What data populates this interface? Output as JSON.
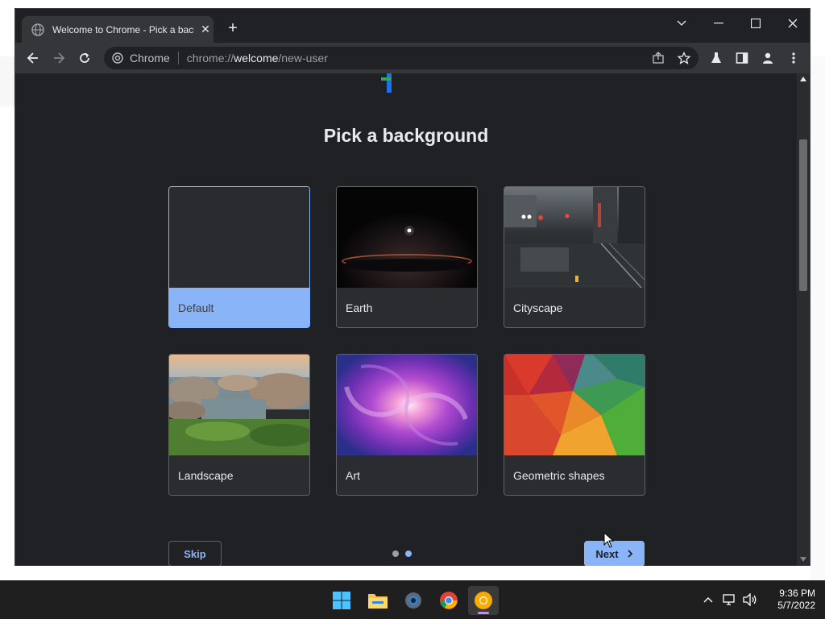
{
  "browser": {
    "tab_title": "Welcome to Chrome - Pick a background",
    "site_name": "Chrome",
    "url_scheme": "chrome://",
    "url_host": "welcome",
    "url_path": "/new-user"
  },
  "page": {
    "title": "Pick a background",
    "backgrounds": [
      {
        "label": "Default",
        "selected": true
      },
      {
        "label": "Earth",
        "selected": false
      },
      {
        "label": "Cityscape",
        "selected": false
      },
      {
        "label": "Landscape",
        "selected": false
      },
      {
        "label": "Art",
        "selected": false
      },
      {
        "label": "Geometric shapes",
        "selected": false
      }
    ],
    "skip_label": "Skip",
    "next_label": "Next",
    "step_current": 2,
    "step_total": 2
  },
  "taskbar": {
    "apps": [
      "windows-start-icon",
      "file-explorer-icon",
      "settings-icon",
      "chrome-icon",
      "chrome-canary-icon"
    ],
    "time": "9:36 PM",
    "date": "5/7/2022"
  },
  "colors": {
    "accent": "#8ab4f8",
    "page_background": "#202124",
    "toolbar": "#35363a"
  }
}
